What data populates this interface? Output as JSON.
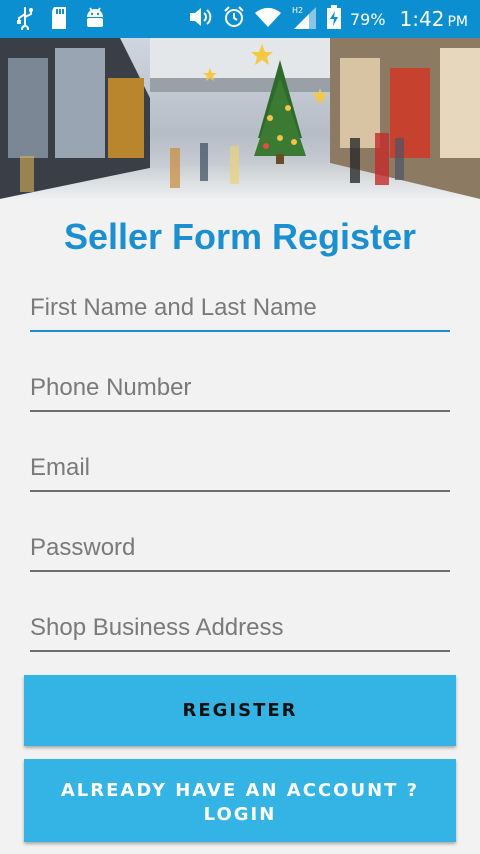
{
  "status_bar": {
    "battery_percent": "79%",
    "time": "1:42",
    "ampm": "PM",
    "icons": [
      "usb-icon",
      "sd-card-icon",
      "android-icon",
      "volume-icon",
      "alarm-icon",
      "wifi-icon",
      "signal-icon",
      "battery-charging-icon"
    ]
  },
  "form": {
    "title": "Seller Form Register",
    "fields": [
      {
        "name": "first-last-name",
        "placeholder": "First Name and Last Name",
        "value": ""
      },
      {
        "name": "phone-number",
        "placeholder": "Phone Number",
        "value": ""
      },
      {
        "name": "email",
        "placeholder": "Email",
        "value": ""
      },
      {
        "name": "password",
        "placeholder": "Password",
        "value": ""
      },
      {
        "name": "shop-business-address",
        "placeholder": "Shop Business Address",
        "value": ""
      }
    ],
    "register_label": "REGISTER",
    "login_line1": "ALREADY HAVE AN ACCOUNT ?",
    "login_line2": "LOGIN"
  },
  "colors": {
    "status_bar": "#0c8fd0",
    "accent": "#1b8fcf",
    "button": "#33b4e5"
  }
}
